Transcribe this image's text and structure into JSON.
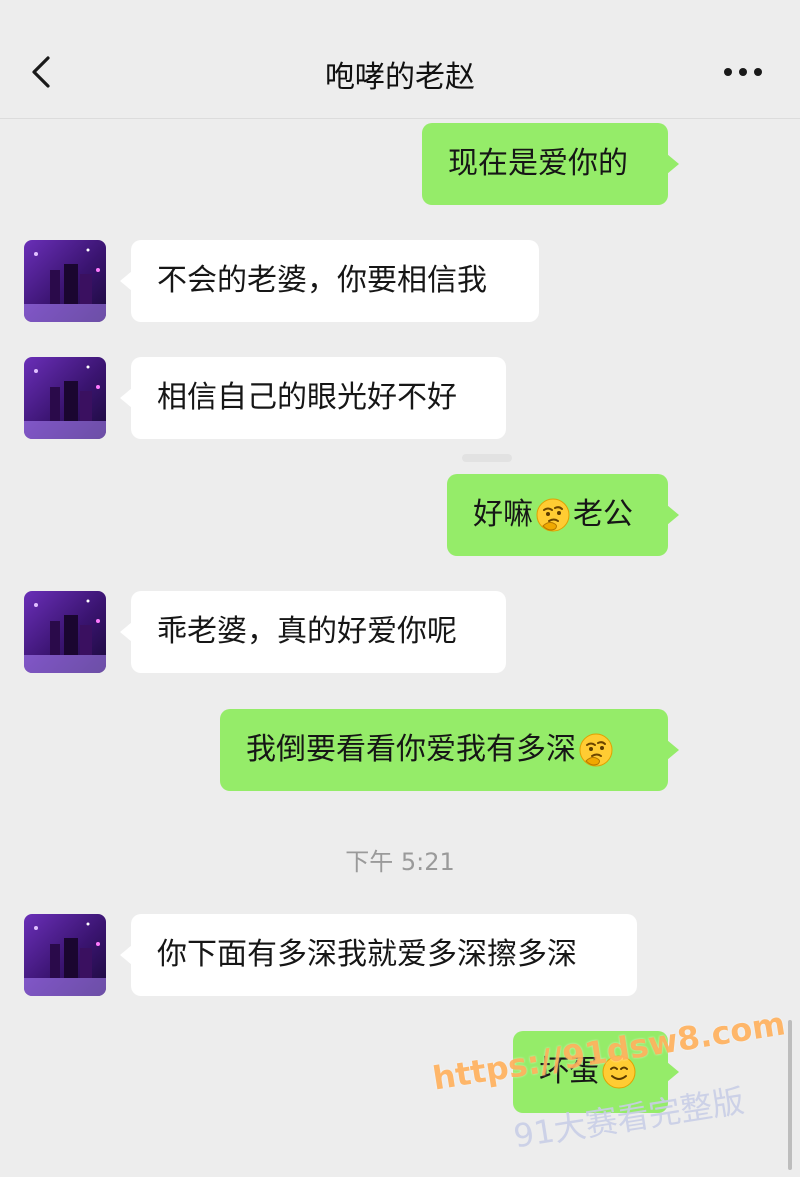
{
  "header": {
    "title": "咆哮的老赵"
  },
  "messages": [
    {
      "side": "out",
      "text": "现在是爱你的"
    },
    {
      "side": "in",
      "text": "不会的老婆，你要相信我"
    },
    {
      "side": "in",
      "text": "相信自己的眼光好不好"
    },
    {
      "side": "out",
      "text_before": "好嘛",
      "emoji": "thinking-face-emoji",
      "text_after": "老公"
    },
    {
      "side": "in",
      "text": "乖老婆，真的好爱你呢"
    },
    {
      "side": "out",
      "text_before": "我倒要看看你爱我有多深",
      "emoji": "thinking-face-emoji"
    },
    {
      "side": "in",
      "text": "你下面有多深我就爱多深擦多深"
    },
    {
      "side": "out",
      "text_before": "坏蛋",
      "emoji": "smiling-face-emoji"
    }
  ],
  "timestamp": "下午 5:21",
  "watermark": {
    "url": "https://91dsw8.com",
    "text": "91大赛看完整版"
  },
  "colors": {
    "background": "#ededed",
    "outgoing_bubble": "#95ec69",
    "incoming_bubble": "#ffffff"
  }
}
